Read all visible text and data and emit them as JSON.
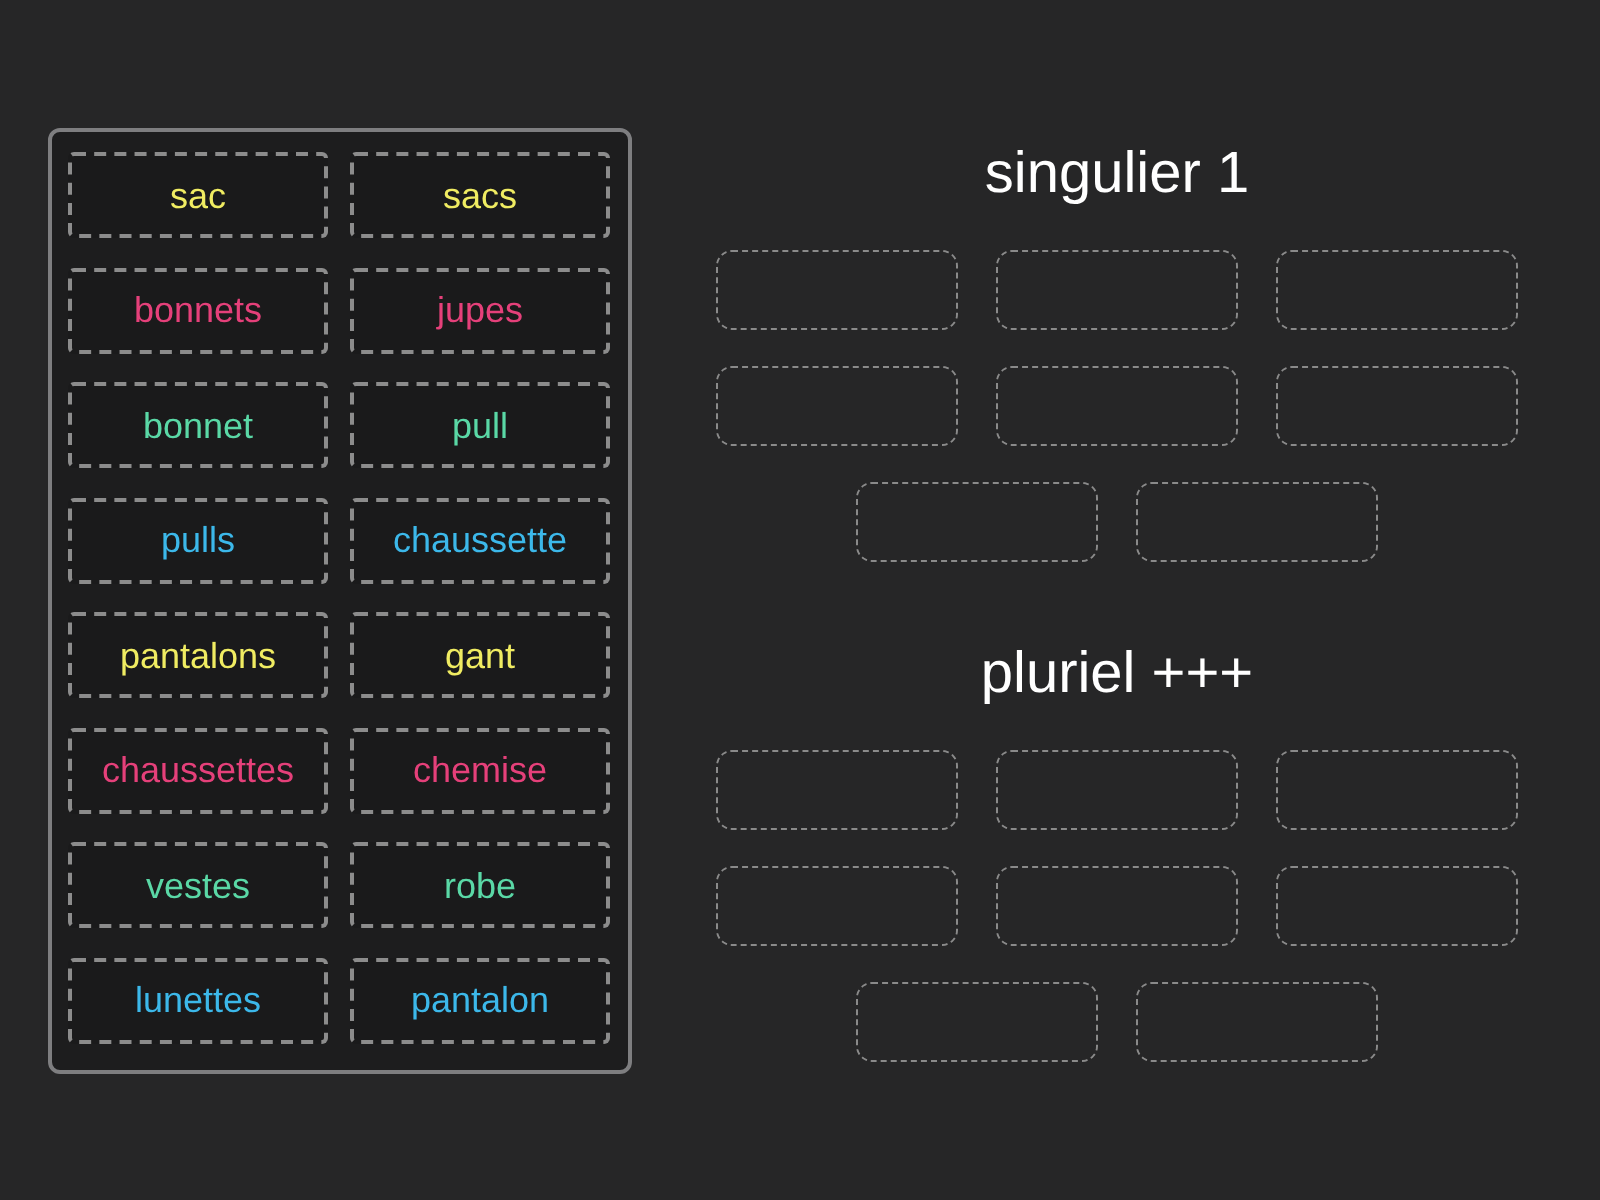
{
  "tiles": [
    {
      "text": "sac",
      "color": "#f0ec62"
    },
    {
      "text": "sacs",
      "color": "#f0ec62"
    },
    {
      "text": "bonnets",
      "color": "#e5407a"
    },
    {
      "text": "jupes",
      "color": "#e5407a"
    },
    {
      "text": "bonnet",
      "color": "#5ad8a6"
    },
    {
      "text": "pull",
      "color": "#5ad8a6"
    },
    {
      "text": "pulls",
      "color": "#3cb8ea"
    },
    {
      "text": "chaussette",
      "color": "#3cb8ea"
    },
    {
      "text": "pantalons",
      "color": "#f0ec62"
    },
    {
      "text": "gant",
      "color": "#f0ec62"
    },
    {
      "text": "chaussettes",
      "color": "#e5407a"
    },
    {
      "text": "chemise",
      "color": "#e5407a"
    },
    {
      "text": "vestes",
      "color": "#5ad8a6"
    },
    {
      "text": "robe",
      "color": "#5ad8a6"
    },
    {
      "text": "lunettes",
      "color": "#3cb8ea"
    },
    {
      "text": "pantalon",
      "color": "#3cb8ea"
    }
  ],
  "groups": [
    {
      "title": "singulier 1"
    },
    {
      "title": "pluriel +++"
    }
  ]
}
